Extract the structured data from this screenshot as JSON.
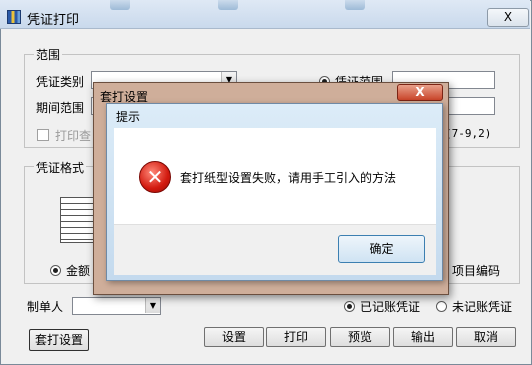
{
  "main_window": {
    "title": "凭证打印",
    "close_label": "X"
  },
  "range_group": {
    "label": "范围",
    "voucher_type_label": "凭证类别",
    "period_label": "期间范围",
    "voucher_range_label": "凭证范围",
    "print_checkbox_label": "打印查",
    "hint_text": "(7-9,2)"
  },
  "format_group": {
    "label": "凭证格式",
    "amount_radio_label": "金额",
    "project_code_label": "项目编码"
  },
  "bottom": {
    "maker_label": "制单人",
    "booked_label": "已记账凭证",
    "unbooked_label": "未记账凭证",
    "buttons": {
      "setup_print": "套打设置",
      "settings": "设置",
      "print": "打印",
      "preview": "预览",
      "export": "输出",
      "cancel": "取消"
    }
  },
  "dialog_setup": {
    "title": "套打设置",
    "close_label": "X"
  },
  "dialog_alert": {
    "title": "提示",
    "message": "套打纸型设置失败，请用手工引入的方法",
    "ok_label": "确定",
    "icon": "error-icon"
  }
}
